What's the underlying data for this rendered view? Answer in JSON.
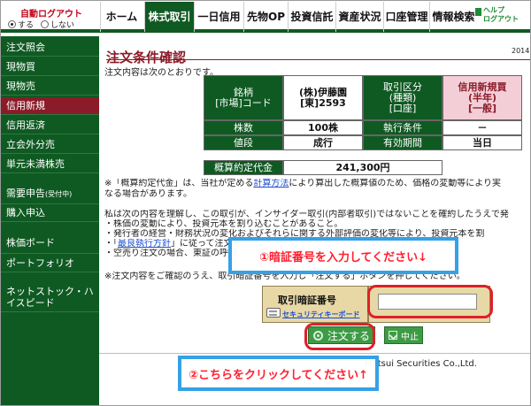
{
  "topbar": {
    "logout": {
      "title": "自動ログアウト",
      "options": [
        "する",
        "しない"
      ],
      "selected": "する"
    },
    "tabs": [
      "ホーム",
      "株式取引",
      "一日信用",
      "先物OP",
      "投資信託",
      "資産状況",
      "口座管理",
      "情報検索"
    ],
    "active_tab": "株式取引",
    "help_logout": [
      "ヘルプ",
      "ログアウト"
    ]
  },
  "sidebar": {
    "items": [
      "注文照会",
      "現物買",
      "現物売",
      "信用新規",
      "信用返済",
      "立会外分売",
      "単元未満株売"
    ],
    "active_item": "信用新規",
    "group_items": [
      "需要申告",
      "購入申込",
      "株価ボード",
      "ポートフォリオ",
      "ネットストック・ハイスピード"
    ],
    "demand_suffix": "(受付中)"
  },
  "page": {
    "title": "注文条件確認",
    "year": "2014",
    "intro": "注文内容は次のとおりです。"
  },
  "order": {
    "meigara_label": "銘柄\n[市場]コード",
    "meigara_value": "(株)伊藤園\n[東]2593",
    "torihiki_label": "取引区分\n(種類)\n[口座]",
    "torihiki_value": "信用新規買\n(半年)\n[一般]",
    "shares_label": "株数",
    "shares_value": "100株",
    "condition_label": "執行条件",
    "condition_value": "－",
    "price_label": "値段",
    "price_value": "成行",
    "period_label": "有効期間",
    "period_value": "当日",
    "estimated_label": "概算約定代金",
    "estimated_value": "241,300円"
  },
  "notes": {
    "estimate_line1_prefix": "※「概算約定代金」は、当社が定める",
    "estimate_link": "計算方法",
    "estimate_line1_suffix": "により算出した概算値のため、価格の変動等により実",
    "estimate_line2": "なる場合があります。",
    "confirm1": "私は次の内容を理解し、この取引が、インサイダー取引(内部者取引)ではないことを確約したうえで発",
    "confirm2": "・株価の変動により、投資元本を割り込むことがあること。",
    "confirm3": "・発行者の経営・財務状況の変化およびそれらに関する外部評価の変化等により、投資元本を割",
    "confirm4_prefix": "・「",
    "confirm4_link": "最良執行方針",
    "confirm4_suffix": "」に従って注文が",
    "confirm5": "・空売り注文の場合、東証の呼値",
    "confirm6": "※注文内容をご確認のうえ、取引暗証番号を入力し「注文する」ボタンを押してください。"
  },
  "pin": {
    "title": "取引暗証番号",
    "security_keyboard": "セキュリティキーボード",
    "value": "",
    "placeholder": ""
  },
  "buttons": {
    "submit": "注文する",
    "stop": "中止"
  },
  "footer": "Matsui Securities Co.,Ltd.",
  "callouts": {
    "pin": "①暗証番号を入力してください↓",
    "click": "②こちらをクリックしてください↑"
  },
  "colors": {
    "brand": "#0f5a22",
    "active": "#8b1b28",
    "callout_red": "#df2027",
    "callout_blue": "#35a1e6",
    "button": "#3e9b45"
  }
}
